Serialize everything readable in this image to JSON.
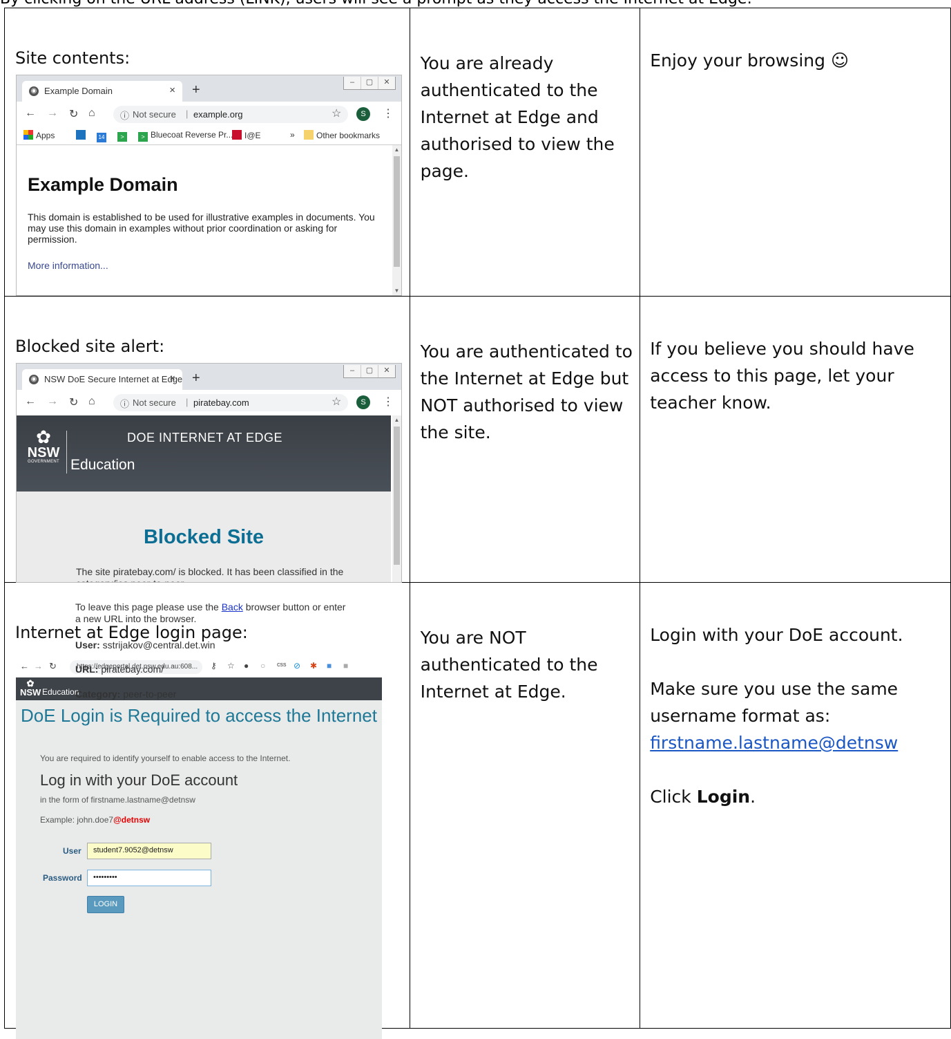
{
  "top_text": "By clicking on the URL address (LINK), users will see a prompt as they access the Internet at Edge:",
  "row1": {
    "caption": "Site contents:",
    "status": "You are already authenticated to the Internet at Edge and authorised to view the page.",
    "advice": "Enjoy your browsing ☺",
    "browser": {
      "tab_title": "Example Domain",
      "not_secure": "Not secure",
      "host": "example.org",
      "avatar_letter": "S",
      "bookmarks": [
        "Apps",
        "14",
        "Bluecoat Reverse Pr...",
        "I@E",
        "»",
        "Other bookmarks"
      ],
      "page_title": "Example Domain",
      "page_text": "This domain is established to be used for illustrative examples in documents. You may use this domain in examples without prior coordination or asking for permission.",
      "page_link": "More information..."
    }
  },
  "row2": {
    "caption": "Blocked site alert:",
    "status": "You are authenticated to the Internet at Edge but NOT authorised to view the site.",
    "advice": "If you believe you should have access to this page, let your teacher know.",
    "browser": {
      "tab_title": "NSW DoE Secure Internet at Edge",
      "not_secure": "Not secure",
      "host": "piratebay.com",
      "avatar_letter": "S",
      "logo_word": "NSW",
      "logo_gov": "GOVERNMENT",
      "edu_label": "Education",
      "header_title": "DOE INTERNET AT EDGE",
      "blocked_title": "Blocked Site",
      "p1": "The site piratebay.com/ is blocked. It has been classified in the category/ies peer-to-peer.",
      "p2_before": "To leave this page please use the ",
      "p2_link": "Back",
      "p2_after": " browser button or enter a new URL into the browser.",
      "user_label": "User:",
      "user_value": " sstrijakov@central.det.win",
      "url_label": "URL:",
      "url_value": " piratebay.com/",
      "cat_label": "Category:",
      "cat_value": " peer-to-peer"
    }
  },
  "row3": {
    "caption": "Internet at Edge login page:",
    "status": "You are NOT authenticated to the Internet at Edge.",
    "advice_1": "Login with your DoE account.",
    "advice_2": "Make sure you use the same username format as:",
    "advice_link": "firstname.lastname@detnsw",
    "advice_3_pre": "Click ",
    "advice_3_bold": "Login",
    "advice_3_post": ".",
    "login": {
      "url": "https://edgeportal.det.nsw.edu.au:608...",
      "logo_word": "NSW",
      "edu_label": "Education",
      "title": "DoE Login is Required to access the Internet",
      "subtitle": "You are required to identify yourself to enable access to the Internet.",
      "heading": "Log in with your DoE account",
      "form_hint": "in the form of firstname.lastname@detnsw",
      "example_pre": "Example: john.doe7",
      "example_red": "@detnsw",
      "user_label": "User",
      "user_value": "student7.9052@detnsw",
      "password_label": "Password",
      "password_value": "•••••••••",
      "button": "LOGIN"
    }
  },
  "colors": {
    "link_blue": "#1a56c4",
    "blocked_title": "#0d6e93",
    "login_title": "#1e7896",
    "header_dark": "#3d4349",
    "login_button": "#5b9abf"
  }
}
